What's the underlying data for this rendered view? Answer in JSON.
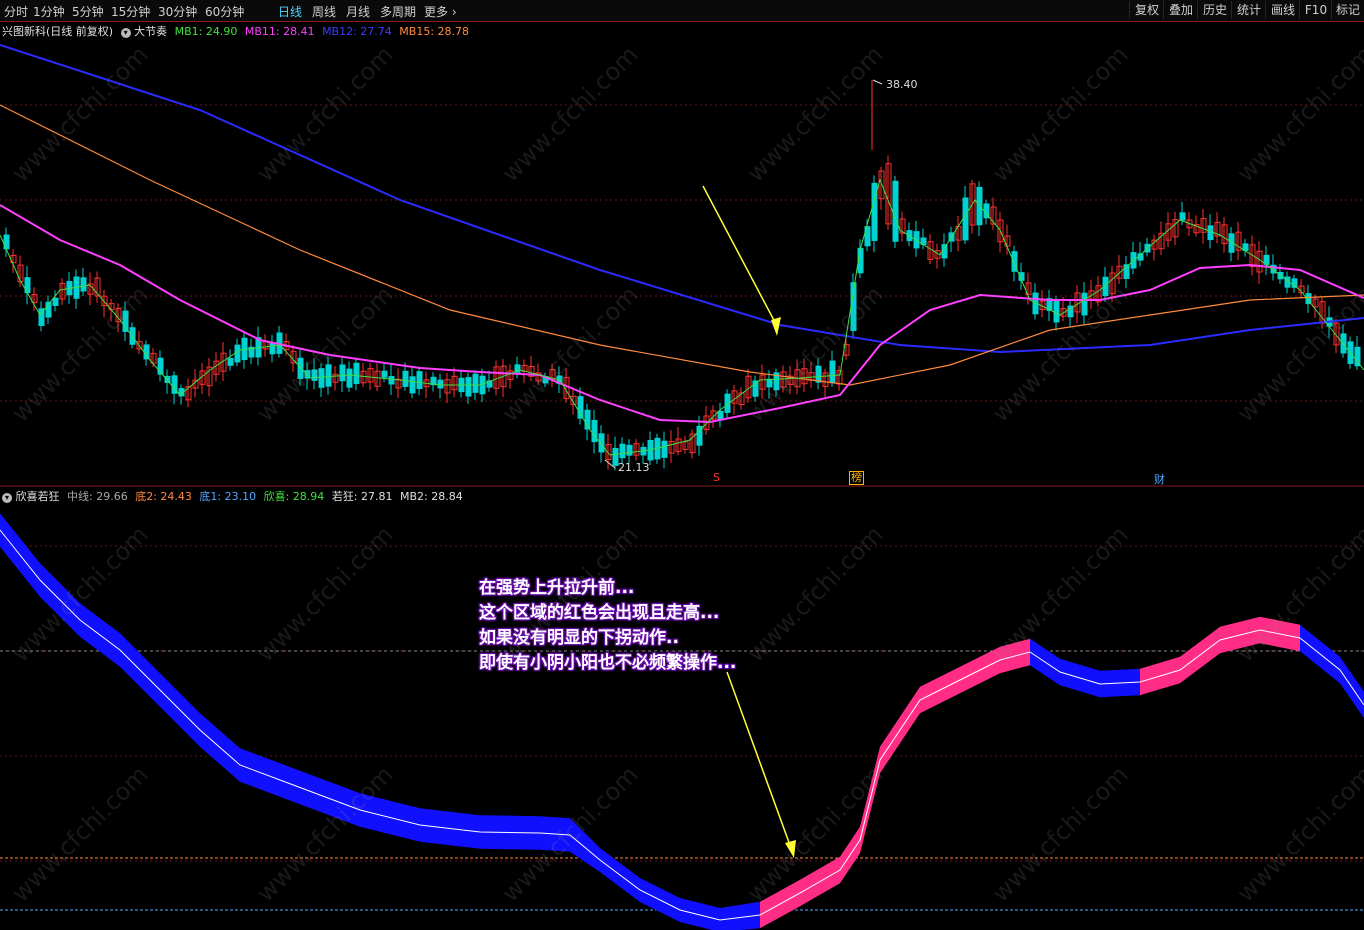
{
  "toolbar": {
    "periods": [
      "分时",
      "1分钟",
      "5分钟",
      "15分钟",
      "30分钟",
      "60分钟",
      "日线",
      "周线",
      "月线",
      "多周期",
      "更多"
    ],
    "active_period": "日线",
    "right_buttons": [
      "复权",
      "叠加",
      "历史",
      "统计",
      "画线",
      "F10",
      "标记"
    ]
  },
  "main_header": {
    "stock": "兴图新科(日线 前复权)",
    "indicator": "大节奏",
    "mb1": "MB1: 24.90",
    "mb11": "MB11: 28.41",
    "mb12": "MB12: 27.74",
    "mb15": "MB15: 28.78"
  },
  "sub_header": {
    "name": "欣喜若狂",
    "zhongxian": "中线: 29.66",
    "di2": "底2: 24.43",
    "di1": "底1: 23.10",
    "xinxi": "欣喜: 28.94",
    "ruokuang": "若狂: 27.81",
    "mb2": "MB2: 28.84"
  },
  "price_labels": {
    "high": "38.40",
    "low": "21.13"
  },
  "markers": [
    "S",
    "榜",
    "财"
  ],
  "annotation": [
    "在强势上升拉升前...",
    "这个区域的红色会出现且走高...",
    "如果没有明显的下拐动作..",
    "即使有小阴小阳也不必频繁操作..."
  ],
  "watermark": "www.cfchi.com",
  "colors": {
    "up": "#ff3030",
    "down": "#00d2d2",
    "mb1": "#40e040",
    "mb11": "#ff40ff",
    "mb12": "#2b2bff",
    "mb15": "#ff8a3d",
    "band_up": "#ff2d86",
    "band_down": "#1010ff",
    "annotation_arrow": "#ffff33"
  }
}
